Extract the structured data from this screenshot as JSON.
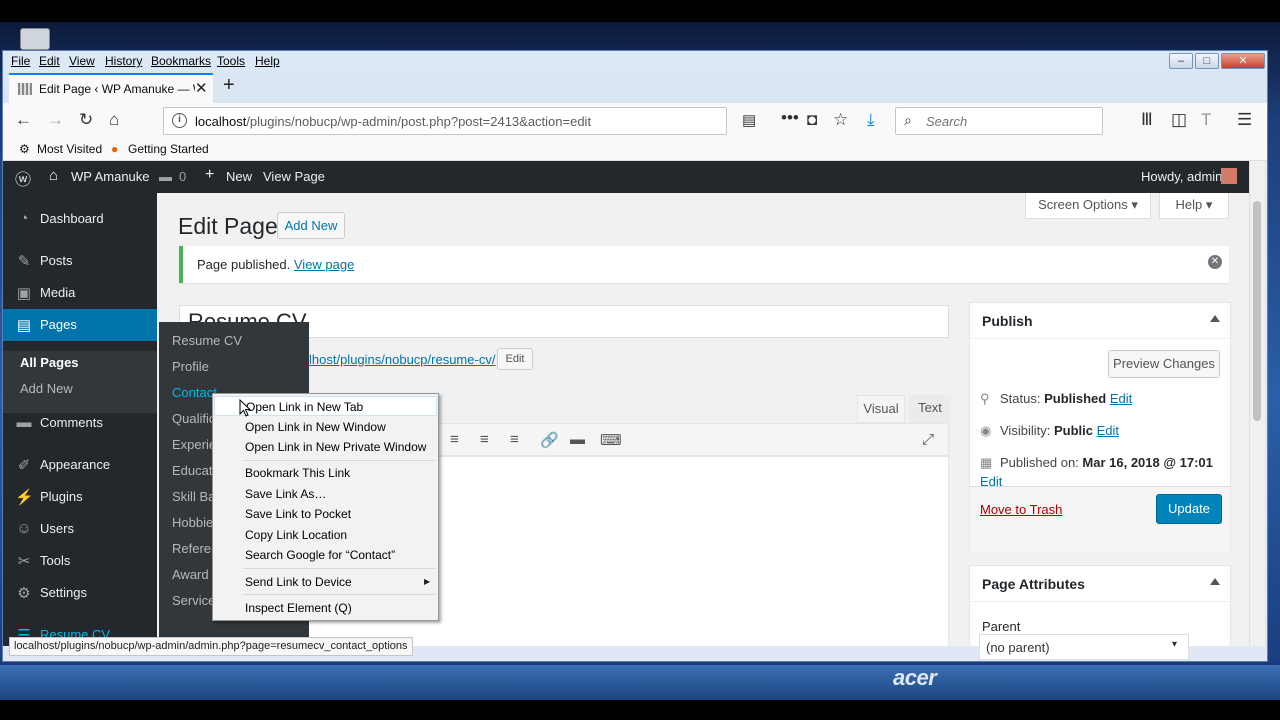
{
  "browser": {
    "menu": [
      "File",
      "Edit",
      "View",
      "History",
      "Bookmarks",
      "Tools",
      "Help"
    ],
    "tab_title": "Edit Page ‹ WP Amanuke — W",
    "url_host": "localhost",
    "url_path": "/plugins/nobucp/wp-admin/post.php?post=2413&action=edit",
    "search_placeholder": "Search",
    "bookmarks": [
      "Most Visited",
      "Getting Started"
    ],
    "status_link": "localhost/plugins/nobucp/wp-admin/admin.php?page=resumecv_contact_options"
  },
  "adminbar": {
    "site_name": "WP Amanuke",
    "comment_count": "0",
    "new_label": "New",
    "view_page": "View Page",
    "howdy": "Howdy, admin"
  },
  "sidebar": {
    "items": [
      "Dashboard",
      "Posts",
      "Media",
      "Pages",
      "Comments",
      "Appearance",
      "Plugins",
      "Users",
      "Tools",
      "Settings",
      "Resume CV"
    ],
    "submenu": [
      "All Pages",
      "Add New"
    ]
  },
  "flyout": [
    "Resume CV",
    "Profile",
    "Contact",
    "Qualific",
    "Experien",
    "Educatio",
    "Skill Bar",
    "Hobbies",
    "Referen",
    "Award",
    "Service"
  ],
  "main": {
    "title": "Edit Page",
    "add_new": "Add New",
    "screen_options": "Screen Options",
    "help": "Help",
    "notice": "Page published.",
    "notice_link": "View page",
    "post_title": "Resume CV",
    "permalink": "lhost/plugins/nobucp/resume-cv/",
    "permalink_edit": "Edit",
    "tab_visual": "Visual",
    "tab_text": "Text"
  },
  "publish": {
    "title": "Publish",
    "preview": "Preview Changes",
    "status_label": "Status:",
    "status_value": "Published",
    "visibility_label": "Visibility:",
    "visibility_value": "Public",
    "published_label": "Published on:",
    "published_value": "Mar 16, 2018 @ 17:01",
    "edit": "Edit",
    "trash": "Move to Trash",
    "update": "Update"
  },
  "attributes": {
    "title": "Page Attributes",
    "parent_label": "Parent",
    "parent_value": "(no parent)"
  },
  "context_menu": [
    "Open Link in New Tab",
    "Open Link in New Window",
    "Open Link in New Private Window",
    "Bookmark This Link",
    "Save Link As…",
    "Save Link to Pocket",
    "Copy Link Location",
    "Search Google for “Contact”",
    "Send Link to Device",
    "Inspect Element (Q)"
  ],
  "branding": "acer",
  "colors": {
    "wp_blue": "#0073aa",
    "admin_dark": "#23282d",
    "update_button": "#0085ba",
    "notice_green": "#46b450",
    "trash_red": "#aa0000"
  }
}
